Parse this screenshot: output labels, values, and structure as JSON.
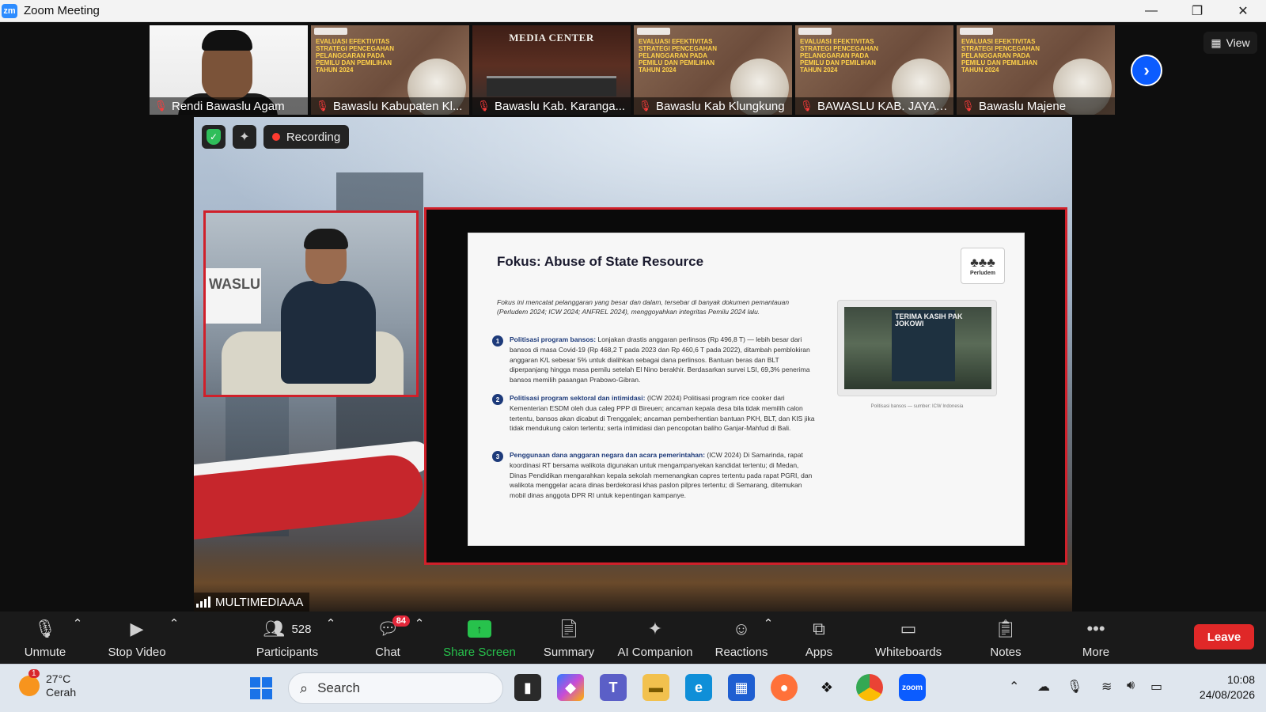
{
  "window": {
    "app_icon": "zm",
    "title": "Zoom Meeting",
    "minimize": "—",
    "restore": "❐",
    "close": "✕"
  },
  "gallery": {
    "thumbnails": [
      {
        "name": "Rendi Bawaslu Agam"
      },
      {
        "name": "Bawaslu Kabupaten Kl..."
      },
      {
        "name": "Bawaslu Kab. Karanga..."
      },
      {
        "name": "Bawaslu Kab Klungkung"
      },
      {
        "name": "BAWASLU KAB. JAYAW..."
      },
      {
        "name": "Bawaslu Majene"
      }
    ],
    "poster_title": "EVALUASI EFEKTIVITAS STRATEGI PENCEGAHAN PELANGGARAN PADA PEMILU DAN PEMILIHAN TAHUN 2024",
    "media_center_title": "MEDIA CENTER",
    "view_label": "View",
    "next_icon": "chevron-right-icon"
  },
  "main": {
    "recording_label": "Recording",
    "speaker_banner": "WASLU",
    "participant_label": "MULTIMEDIAAA",
    "slide": {
      "title": "Fokus: Abuse of State Resource",
      "logo_text": "Perludem",
      "intro": "Fokus ini mencatat pelanggaran yang besar dan dalam, tersebar di banyak dokumen pemantauan (Perludem 2024; ICW 2024; ANFREL 2024), menggoyahkan integritas Pemilu 2024 lalu.",
      "items": [
        {
          "num": "1",
          "head": "Politisasi program bansos:",
          "body": "Lonjakan drastis anggaran perlinsos (Rp 496,8 T) — lebih besar dari bansos di masa Covid-19 (Rp 468,2 T pada 2023 dan Rp 460,6 T pada 2022), ditambah pemblokiran anggaran K/L sebesar 5% untuk dialihkan sebagai dana perlinsos. Bantuan beras dan BLT diperpanjang hingga masa pemilu setelah El Nino berakhir. Berdasarkan survei LSI, 69,3% penerima bansos memilih pasangan Prabowo-Gibran."
        },
        {
          "num": "2",
          "head": "Politisasi program sektoral dan intimidasi:",
          "body": "(ICW 2024) Politisasi program rice cooker dari Kementerian ESDM oleh dua caleg PPP di Bireuen; ancaman kepala desa bila tidak memilih calon tertentu, bansos akan dicabut di Trenggalek; ancaman pemberhentian bantuan PKH, BLT, dan KIS jika tidak mendukung calon tertentu; serta intimidasi dan pencopotan baliho Ganjar-Mahfud di Bali."
        },
        {
          "num": "3",
          "head": "Penggunaan dana anggaran negara dan acara pemerintahan:",
          "body": "(ICW 2024) Di Samarinda, rapat koordinasi RT bersama walikota digunakan untuk mengampanyekan kandidat tertentu; di Medan, Dinas Pendidikan mengarahkan kepala sekolah memenangkan capres tertentu pada rapat PGRI, dan walikota menggelar acara dinas berdekorasi khas paslon pilpres tertentu; di Semarang, ditemukan mobil dinas anggota DPR RI untuk kepentingan kampanye."
        }
      ],
      "photo_text": "TERIMA KASIH PAK JOKOWI",
      "photo_caption": "Politisasi bansos — sumber: ICW Indonesia"
    }
  },
  "controls": {
    "unmute": "Unmute",
    "stop_video": "Stop Video",
    "participants": "Participants",
    "participants_count": "528",
    "chat": "Chat",
    "chat_badge": "84",
    "share_screen": "Share Screen",
    "summary": "Summary",
    "ai_companion": "AI Companion",
    "reactions": "Reactions",
    "apps": "Apps",
    "whiteboards": "Whiteboards",
    "notes": "Notes",
    "more": "More",
    "leave": "Leave"
  },
  "taskbar": {
    "weather_temp": "27°C",
    "weather_desc": "Cerah",
    "weather_badge": "1",
    "search_placeholder": "Search",
    "time": "10:08",
    "date": "24/08/2026"
  },
  "colors": {
    "zoom_blue": "#0b5cff",
    "leave_red": "#e02828",
    "share_green": "#27c24c",
    "frame_red": "#d0202a"
  }
}
